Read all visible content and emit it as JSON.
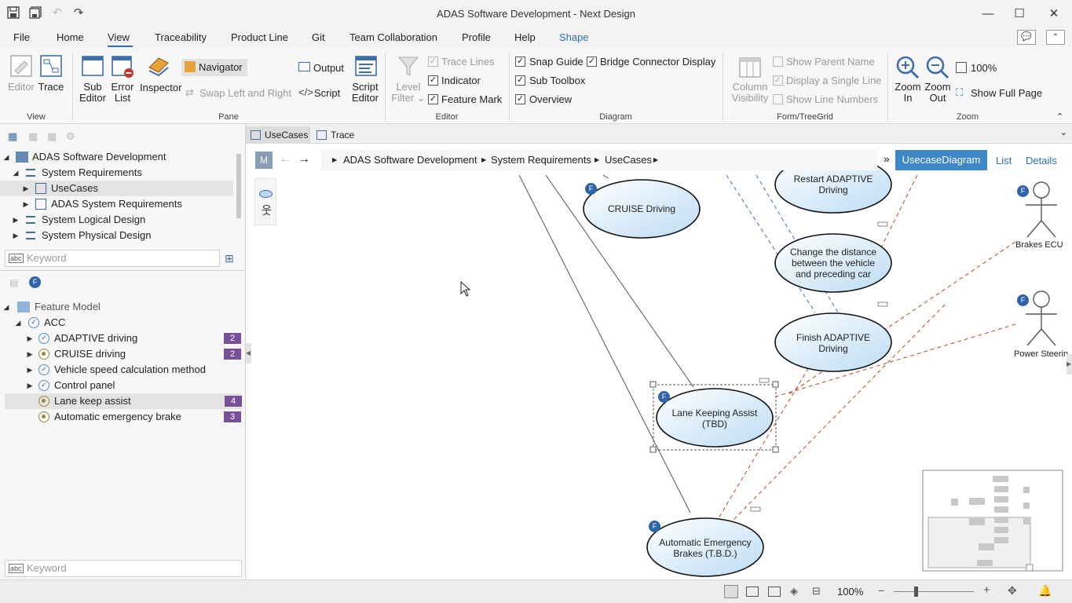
{
  "window": {
    "title": "ADAS Software Development - Next Design"
  },
  "menu": [
    "File",
    "Home",
    "View",
    "Traceability",
    "Product Line",
    "Git",
    "Team Collaboration",
    "Profile",
    "Help",
    "Shape"
  ],
  "ribbon": {
    "view_group": {
      "title": "View",
      "editor": "Editor",
      "trace": "Trace"
    },
    "pane_group": {
      "title": "Pane",
      "sub_editor": [
        "Sub",
        "Editor"
      ],
      "error_list": [
        "Error",
        "List"
      ],
      "inspector": "Inspector",
      "navigator": "Navigator",
      "swap": "Swap Left and Right",
      "output": "Output",
      "script": "Script",
      "script_editor": [
        "Script",
        "Editor"
      ]
    },
    "editor_group": {
      "title": "Editor",
      "level_filter": [
        "Level",
        "Filter"
      ],
      "trace_lines": "Trace Lines",
      "indicator": "Indicator",
      "feature_mark": "Feature Mark"
    },
    "diagram_group": {
      "title": "Diagram",
      "snap_guide": "Snap Guide",
      "bridge_connector": "Bridge Connector Display",
      "sub_toolbox": "Sub Toolbox",
      "overview": "Overview"
    },
    "form_group": {
      "title": "Form/TreeGrid",
      "column_visibility": [
        "Column",
        "Visibility"
      ],
      "show_parent_name": "Show Parent Name",
      "display_single_line": "Display a Single Line",
      "show_line_numbers": "Show Line Numbers"
    },
    "zoom_group": {
      "title": "Zoom",
      "zoom_in": [
        "Zoom",
        "In"
      ],
      "zoom_out": [
        "Zoom",
        "Out"
      ],
      "percent": "100%",
      "show_full_page": "Show Full Page"
    }
  },
  "model_tree": {
    "root": "ADAS Software Development",
    "items": [
      {
        "label": "System Requirements"
      },
      {
        "label": "UseCases"
      },
      {
        "label": "ADAS System Requirements"
      },
      {
        "label": "System Logical Design"
      },
      {
        "label": "System Physical Design"
      }
    ],
    "keyword_placeholder": "Keyword"
  },
  "feature_tree": {
    "root": "Feature Model",
    "acc": "ACC",
    "items": [
      {
        "label": "ADAPTIVE driving",
        "count": "2"
      },
      {
        "label": "CRUISE driving",
        "count": "2"
      },
      {
        "label": "Vehicle speed calculation method",
        "count": ""
      },
      {
        "label": "Control panel",
        "count": ""
      },
      {
        "label": "Lane keep assist",
        "count": "4"
      },
      {
        "label": "Automatic emergency brake",
        "count": "3"
      }
    ],
    "keyword_placeholder": "Keyword"
  },
  "tabs": [
    "UseCases",
    "Trace"
  ],
  "breadcrumb": {
    "model_btn": "M",
    "path": [
      "ADAS Software Development",
      "System Requirements",
      "UseCases"
    ],
    "more": "»",
    "views": {
      "active": "UsecaseDiagram",
      "list": "List",
      "details": "Details"
    }
  },
  "diagram": {
    "feature_mark": "F",
    "usecases": {
      "cruise": "CRUISE Driving",
      "restart": [
        "Restart ADAPTIVE",
        "Driving"
      ],
      "change": [
        "Change the distance",
        "between the vehicle",
        "and preceding car"
      ],
      "finish": [
        "Finish ADAPTIVE",
        "Driving"
      ],
      "lane": [
        "Lane Keeping Assist",
        "(TBD)"
      ],
      "aeb": [
        "Automatic Emergency",
        "Brakes  (T.B.D.)"
      ]
    },
    "actors": {
      "brakes": "Brakes ECU",
      "steering": "Power Steerin"
    }
  },
  "status": {
    "zoom": "100%"
  },
  "colors": {
    "accent": "#2c6fb5",
    "badge": "#7a4f9a",
    "trace_line": "#b8492a",
    "dashed_blue": "#3b6fb0"
  }
}
